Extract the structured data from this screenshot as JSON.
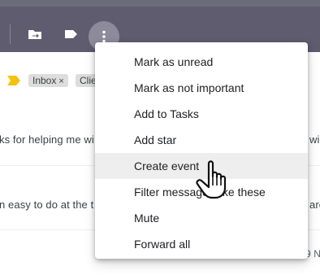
{
  "toolbar": {
    "move_icon": "move-to-icon",
    "label_icon": "label-icon",
    "more_icon": "more-vert-icon"
  },
  "email_row": {
    "labels": [
      {
        "text": "Inbox",
        "close": "×"
      },
      {
        "text": "Clie",
        "close": ""
      }
    ],
    "snippet_left": "ks for helping me wi",
    "snippet_right": "wi"
  },
  "email_row_2": {
    "snippet_left": "n easy to do at the t",
    "snippet_right": "are"
  },
  "email_row_3": {
    "date_fragment": "9 N"
  },
  "menu": {
    "items": [
      {
        "label": "Mark as unread"
      },
      {
        "label": "Mark as not important"
      },
      {
        "label": "Add to Tasks"
      },
      {
        "label": "Add star"
      },
      {
        "label": "Create event"
      },
      {
        "label": "Filter messages like these"
      },
      {
        "label": "Mute"
      },
      {
        "label": "Forward all"
      }
    ],
    "hovered_index": 4
  },
  "colors": {
    "toolbar": "#5f5c70",
    "important_marker": "#f4c20d",
    "menu_hover": "#eeeeee"
  }
}
